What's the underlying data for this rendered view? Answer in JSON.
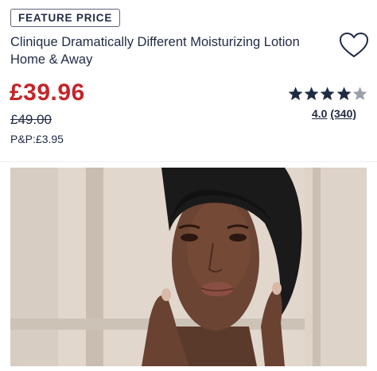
{
  "badge": {
    "label": "FEATURE PRICE"
  },
  "product": {
    "title": "Clinique Dramatically Different Moisturizing Lotion Home & Away",
    "price": "£39.96",
    "was_price": "£49.00",
    "shipping": "P&P:£3.95"
  },
  "rating": {
    "stars": 4,
    "max_stars": 5,
    "value": "4.0",
    "count": "(340)"
  },
  "icons": {
    "wishlist": "heart-outline-icon",
    "star": "star-icon"
  },
  "colors": {
    "price": "#c4252a",
    "text": "#1f2a44",
    "star_filled": "#1f2a44",
    "star_empty": "#9aa0ab"
  },
  "image": {
    "description_visible": false
  }
}
